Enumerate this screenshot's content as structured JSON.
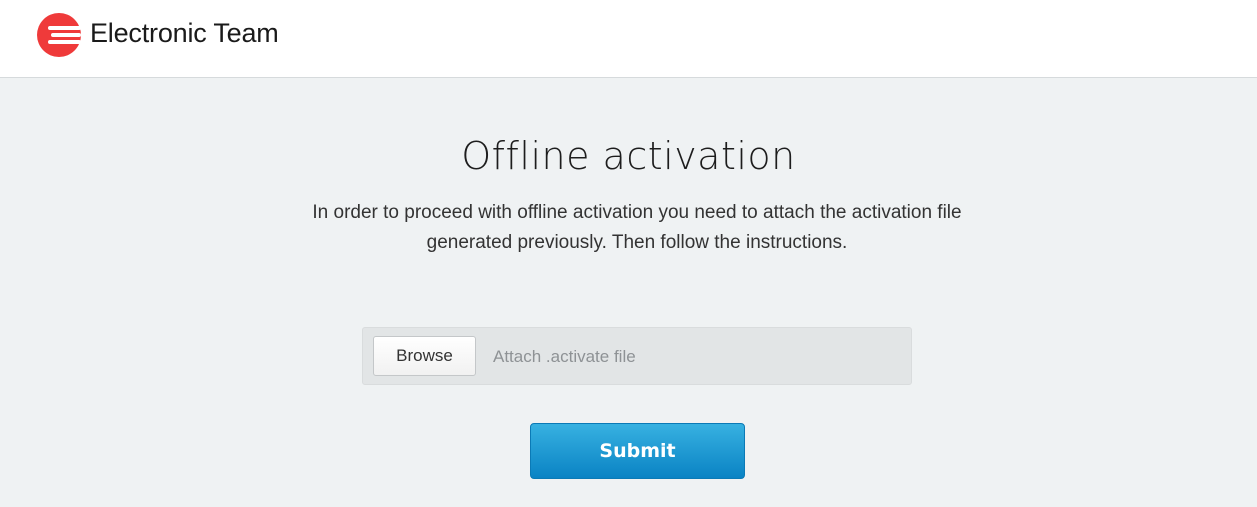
{
  "header": {
    "brand_name": "Electronic Team",
    "logo_icon": "electronic-team-logo",
    "logo_color": "#ef3a3a"
  },
  "main": {
    "title": "Offline activation",
    "description": "In order to proceed with offline activation you need to attach the activation file generated previously. Then follow the instructions.",
    "file_input": {
      "browse_label": "Browse",
      "placeholder": "Attach .activate file"
    },
    "submit_label": "Submit",
    "accent_color": "#1a9ad6"
  }
}
